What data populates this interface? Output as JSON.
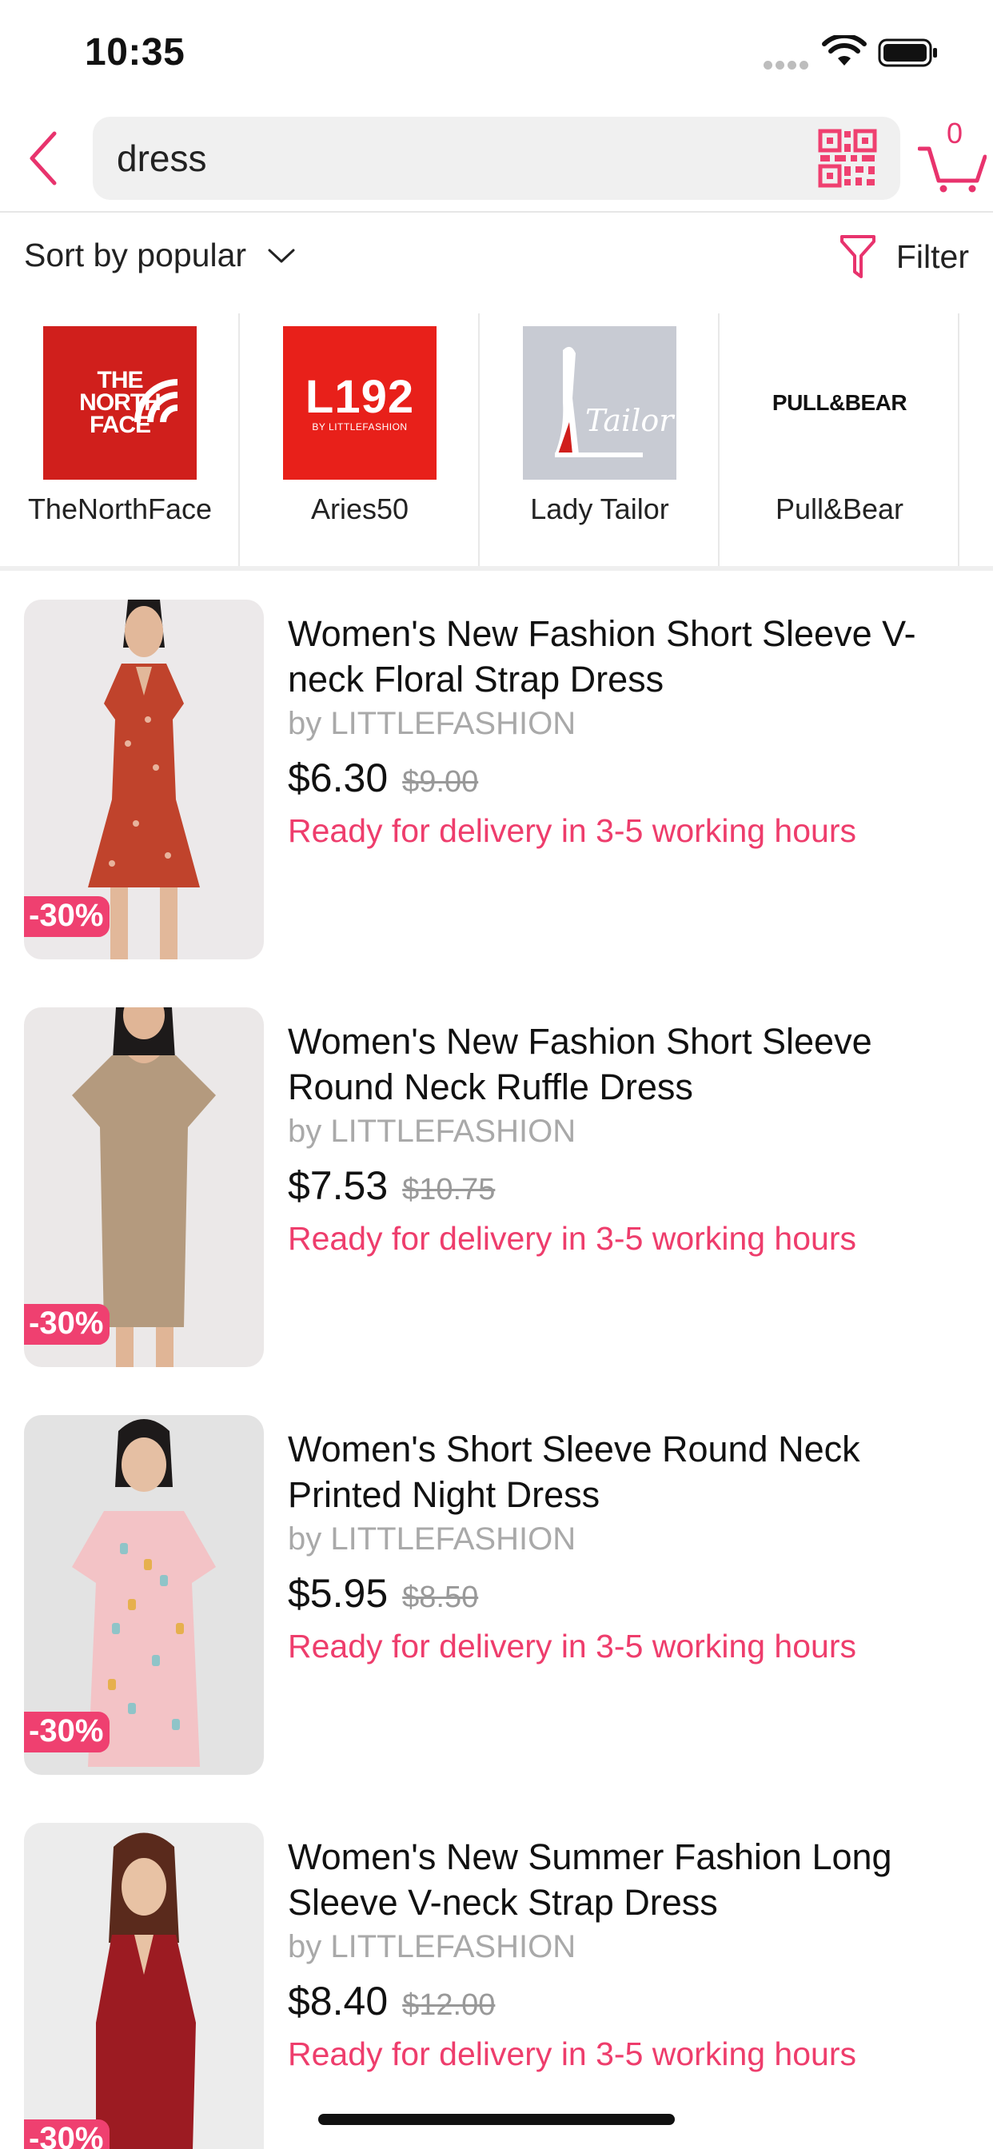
{
  "status_bar": {
    "time": "10:35"
  },
  "search": {
    "query": "dress",
    "cart_count": "0"
  },
  "sort": {
    "label": "Sort by popular",
    "filter_label": "Filter"
  },
  "brands": [
    {
      "name": "TheNorthFace",
      "logo_text": "THE NORTH FACE"
    },
    {
      "name": "Aries50",
      "logo_text": "L192",
      "logo_sub": "BY LITTLEFASHION"
    },
    {
      "name": "Lady Tailor",
      "logo_text": "Tailor"
    },
    {
      "name": "Pull&Bear",
      "logo_text": "PULL&BEAR"
    }
  ],
  "products": [
    {
      "title": "Women's New Fashion Short Sleeve V-neck Floral Strap Dress",
      "seller": "by LITTLEFASHION",
      "price": "$6.30",
      "old_price": "$9.00",
      "discount": "-30%",
      "delivery": "Ready for delivery in 3-5 working hours",
      "image_color": "#c0432c"
    },
    {
      "title": "Women's New Fashion Short Sleeve Round Neck Ruffle Dress",
      "seller": "by LITTLEFASHION",
      "price": "$7.53",
      "old_price": "$10.75",
      "discount": "-30%",
      "delivery": "Ready for delivery in 3-5 working hours",
      "image_color": "#b49a7e"
    },
    {
      "title": "Women's Short Sleeve Round Neck Printed Night Dress",
      "seller": "by LITTLEFASHION",
      "price": "$5.95",
      "old_price": "$8.50",
      "discount": "-30%",
      "delivery": "Ready for delivery in 3-5 working hours",
      "image_color": "#f3c3c6"
    },
    {
      "title": "Women's New Summer Fashion Long Sleeve V-neck Strap Dress",
      "seller": "by LITTLEFASHION",
      "price": "$8.40",
      "old_price": "$12.00",
      "discount": "-30%",
      "delivery": "Ready for delivery in 3-5 working hours",
      "image_color": "#9c1b22"
    }
  ],
  "colors": {
    "accent": "#e8336d",
    "badge": "#ef4070",
    "muted": "#a9a9a9"
  }
}
